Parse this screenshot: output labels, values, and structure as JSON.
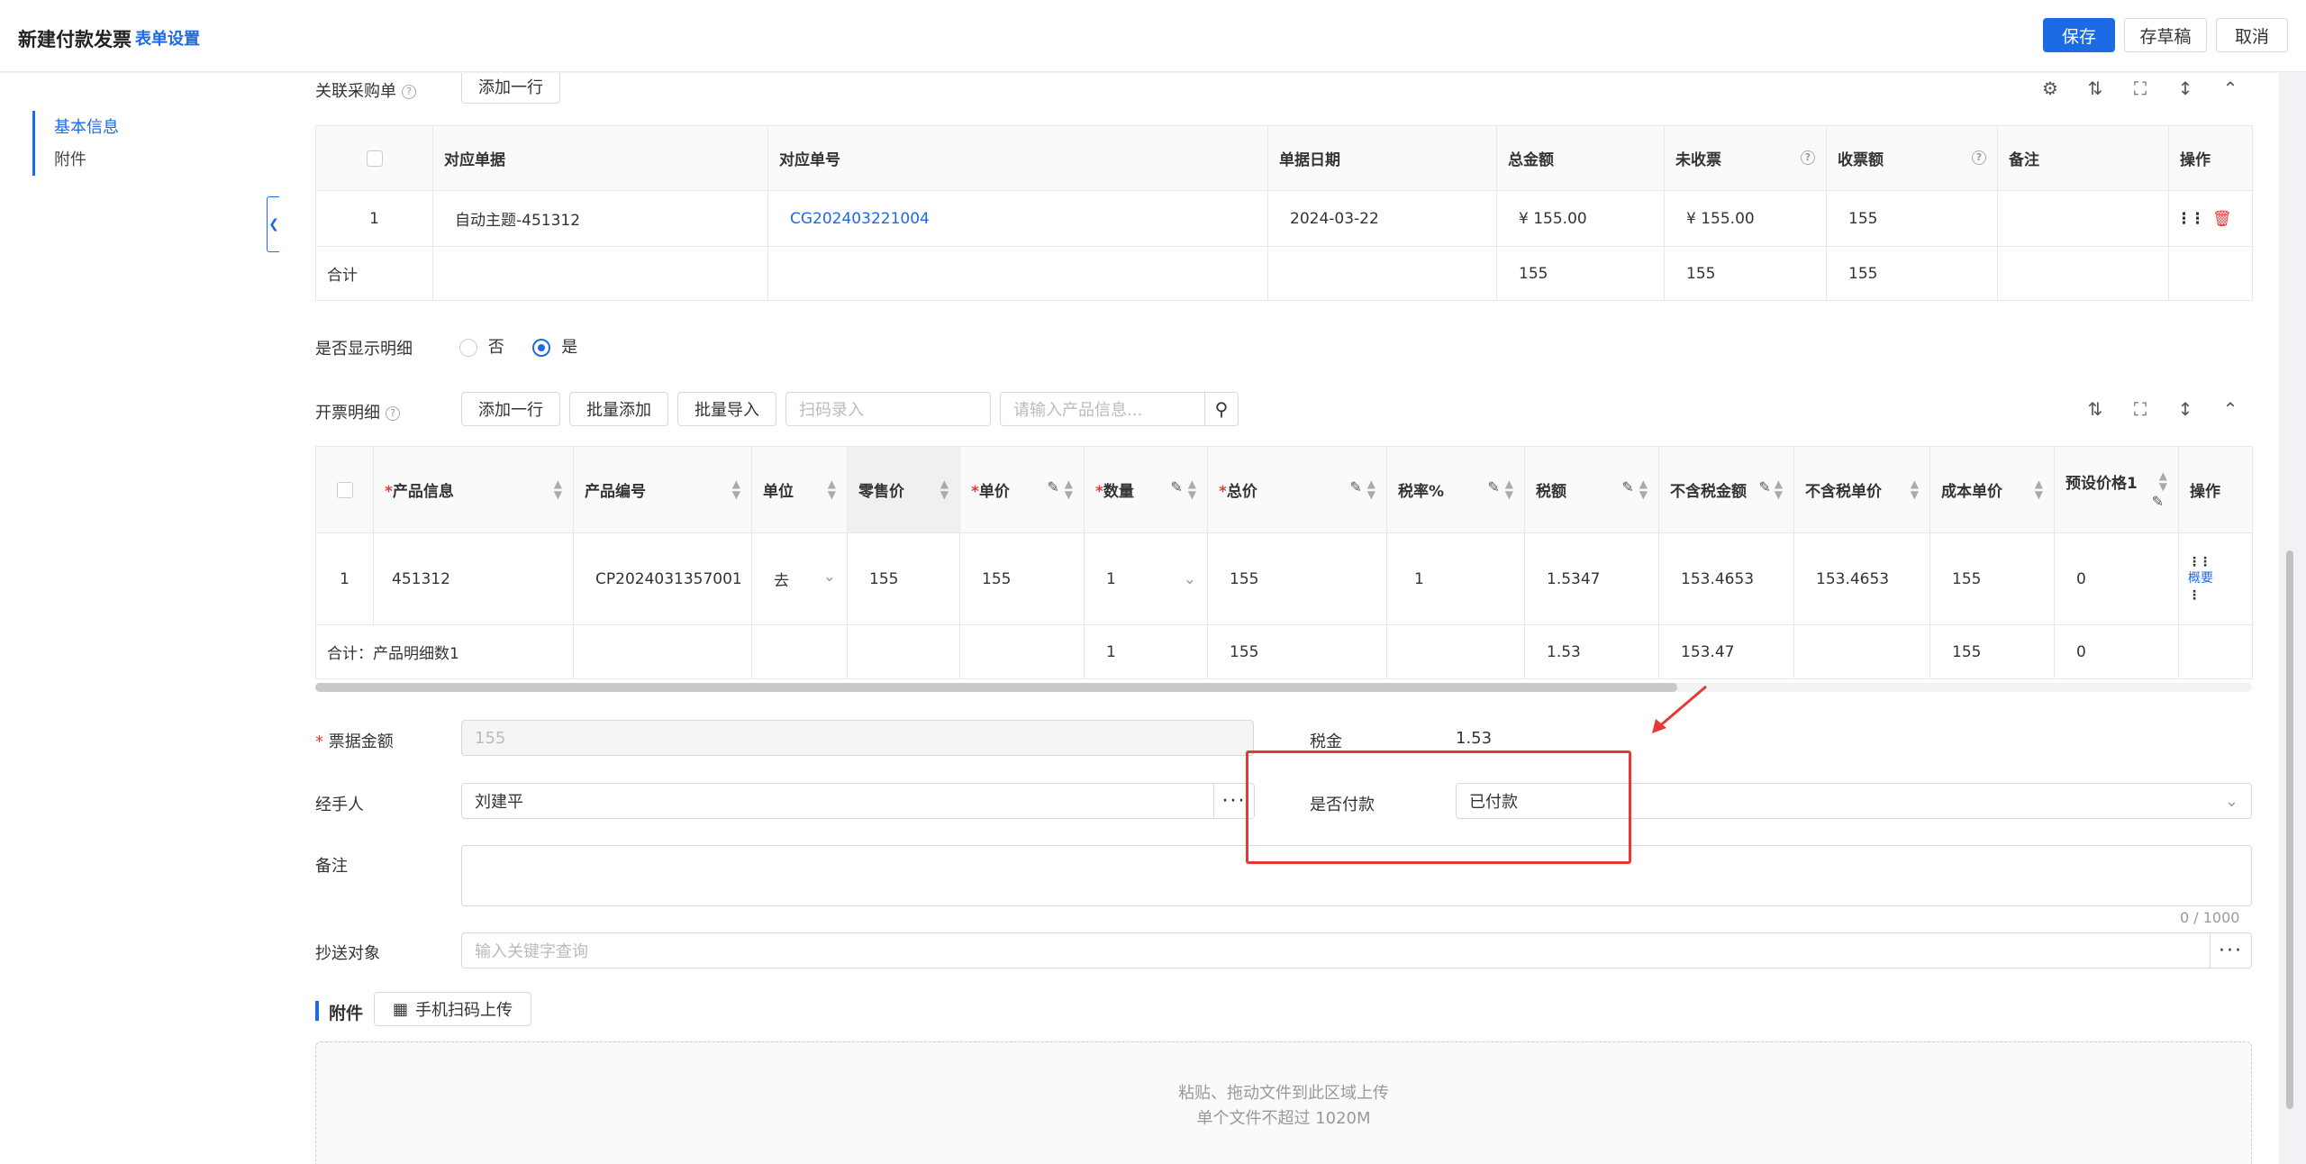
{
  "header": {
    "title": "新建付款发票",
    "form_settings": "表单设置",
    "save": "保存",
    "draft": "存草稿",
    "cancel": "取消"
  },
  "sidebar": {
    "items": [
      {
        "label": "基本信息",
        "active": true
      },
      {
        "label": "附件",
        "active": false
      }
    ]
  },
  "purchase": {
    "label": "关联采购单",
    "add_row": "添加一行",
    "columns": [
      "对应单据",
      "对应单号",
      "单据日期",
      "总金额",
      "未收票",
      "收票额",
      "备注",
      "操作"
    ],
    "rows": [
      {
        "index": "1",
        "doc": "自动主题-451312",
        "doc_no": "CG202403221004",
        "date": "2024-03-22",
        "total": "¥ 155.00",
        "unreceived": "¥ 155.00",
        "received": "155",
        "remark": ""
      }
    ],
    "sum": {
      "label": "合计",
      "total": "155",
      "unreceived": "155",
      "received": "155"
    }
  },
  "show_detail": {
    "label": "是否显示明细",
    "no": "否",
    "yes": "是",
    "selected": "是"
  },
  "invoice_detail": {
    "label": "开票明细",
    "add_row": "添加一行",
    "batch_add": "批量添加",
    "batch_import": "批量导入",
    "scan_placeholder": "扫码录入",
    "product_placeholder": "请输入产品信息...",
    "columns": [
      "产品信息",
      "产品编号",
      "单位",
      "零售价",
      "单价",
      "数量",
      "总价",
      "税率%",
      "税额",
      "不含税金额",
      "不含税单价",
      "成本单价",
      "预设价格1",
      "操作"
    ],
    "rows": [
      {
        "index": "1",
        "product": "451312",
        "code": "CP2024031357001",
        "unit": "去",
        "retail": "155",
        "price": "155",
        "qty": "1",
        "total": "155",
        "tax_rate": "1",
        "tax": "1.5347",
        "ex_tax_amount": "153.4653",
        "ex_tax_price": "153.4653",
        "cost": "155",
        "preset1": "0",
        "op": "概要"
      }
    ],
    "sum": {
      "label": "合计：产品明细数1",
      "qty": "1",
      "total": "155",
      "tax": "1.53",
      "ex_tax_amount": "153.47",
      "cost": "155",
      "preset1": "0"
    }
  },
  "form": {
    "invoice_amount_label": "票据金额",
    "invoice_amount_value": "155",
    "tax_label": "税金",
    "tax_value": "1.53",
    "handler_label": "经手人",
    "handler_value": "刘建平",
    "paid_label": "是否付款",
    "paid_value": "已付款",
    "remark_label": "备注",
    "remark_count": "0 / 1000",
    "cc_label": "抄送对象",
    "cc_placeholder": "输入关键字查询"
  },
  "attachment": {
    "title": "附件",
    "mobile_upload": "手机扫码上传",
    "drop_text": "粘贴、拖动文件到此区域上传",
    "limit_text": "单个文件不超过 1020M"
  },
  "colors": {
    "primary": "#1d6ae5",
    "annotation": "#e53935"
  },
  "icons": {
    "help": "question-circle-icon",
    "search": "search-icon",
    "fullscreen": "fullscreen-icon",
    "collapse": "chevron-up-icon",
    "drag": "drag-grip-icon",
    "delete": "trash-icon",
    "more": "ellipsis-icon",
    "qrcode": "qrcode-icon"
  }
}
